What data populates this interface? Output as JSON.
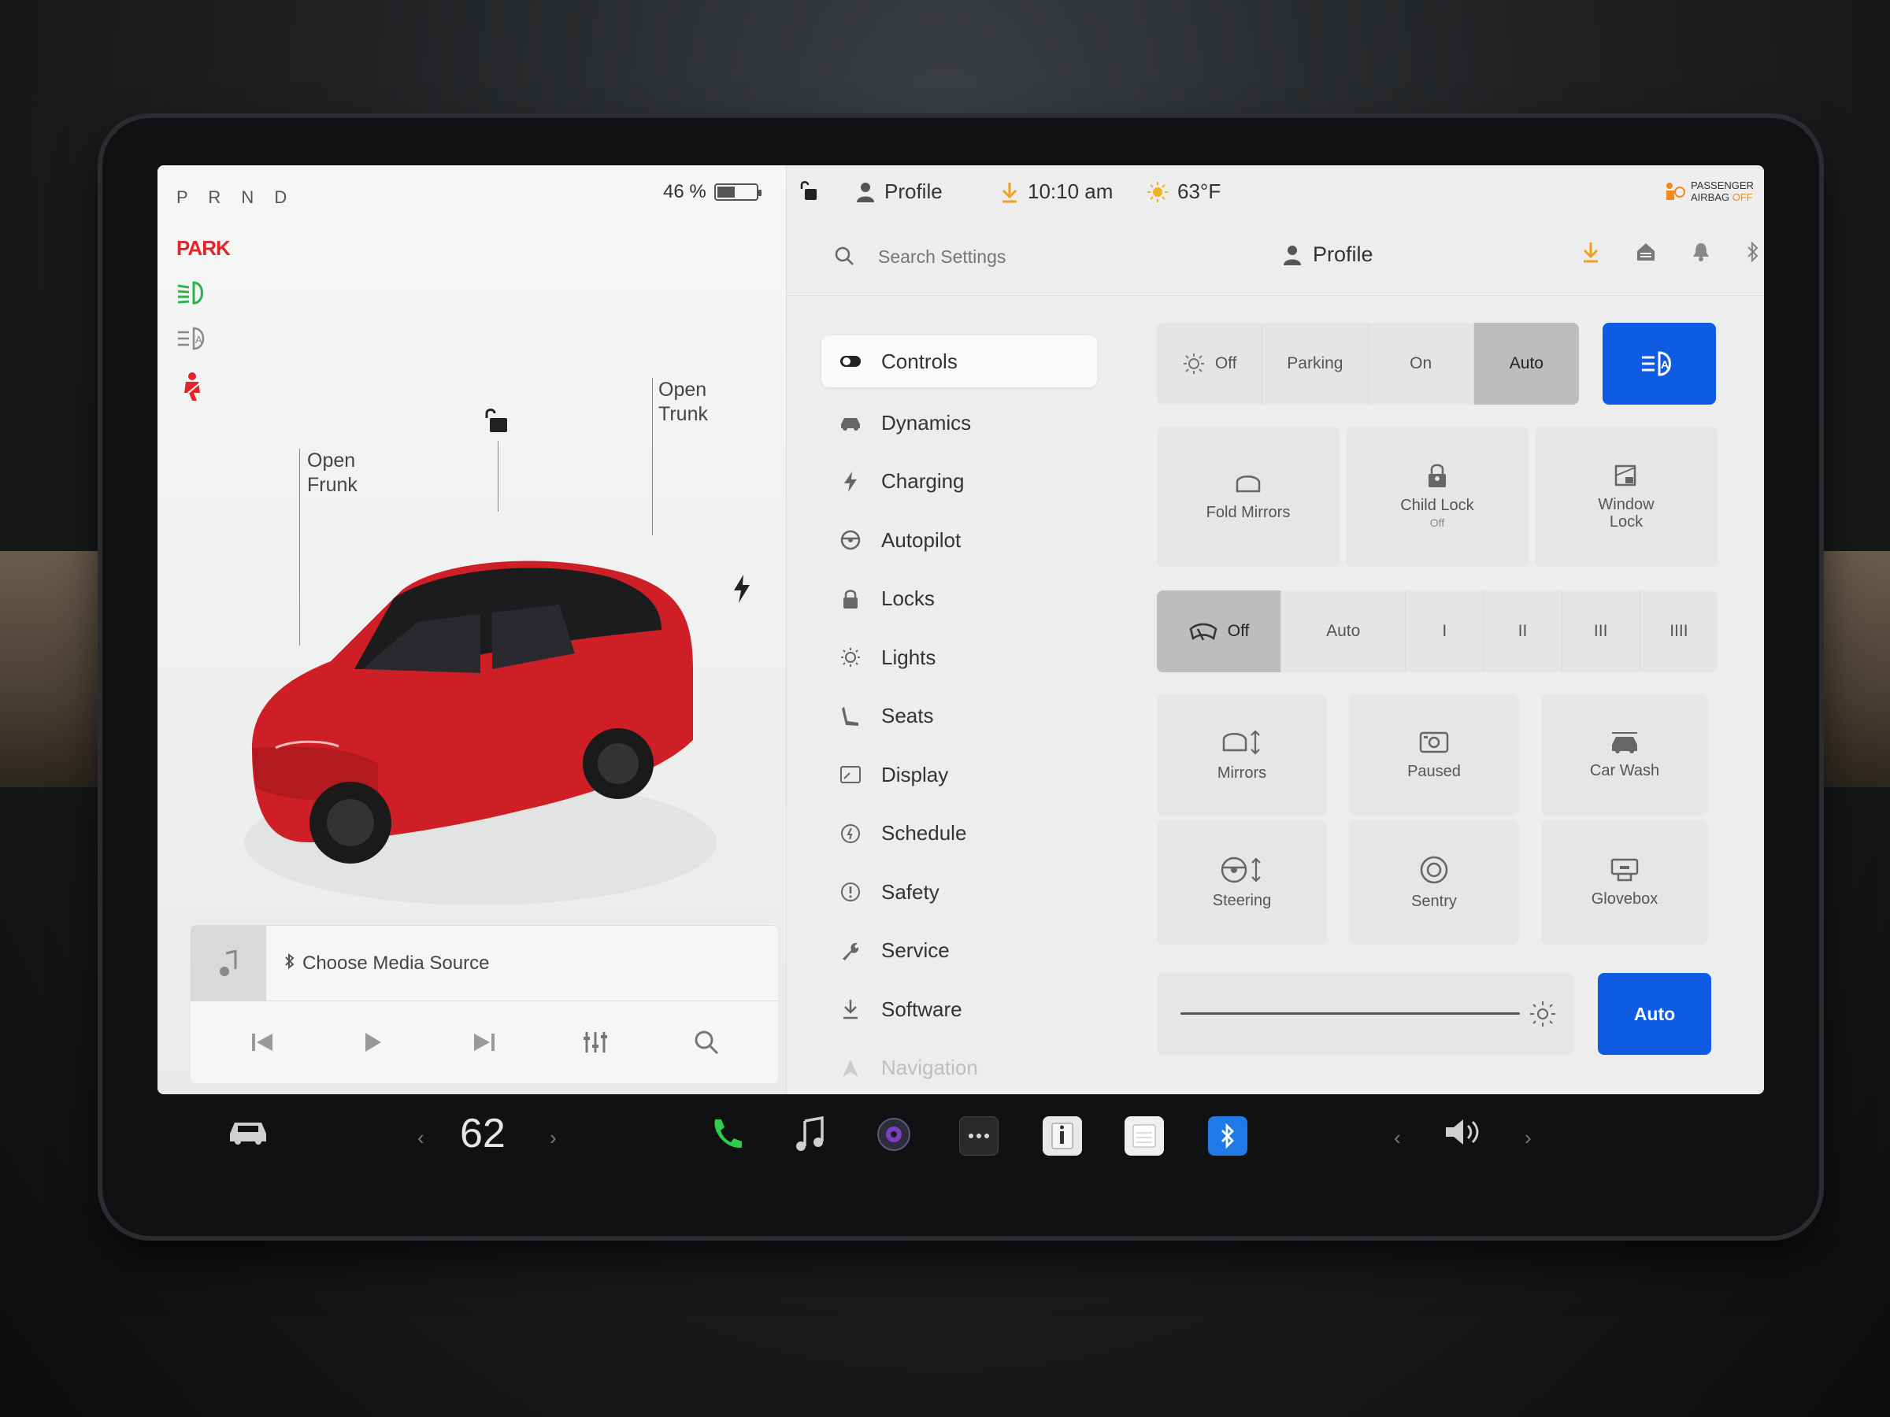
{
  "status": {
    "gear": "P R N D",
    "park_label": "PARK",
    "battery_pct_text": "46 %",
    "battery_level": 0.46
  },
  "car": {
    "frunk_label_1": "Open",
    "frunk_label_2": "Frunk",
    "trunk_label_1": "Open",
    "trunk_label_2": "Trunk"
  },
  "topbar": {
    "profile": "Profile",
    "time": "10:10 am",
    "temp": "63°F",
    "airbag_line1": "PASSENGER",
    "airbag_line2": "AIRBAG",
    "airbag_off": "OFF"
  },
  "search": {
    "placeholder": "Search Settings",
    "profile": "Profile"
  },
  "menu": [
    {
      "label": "Controls"
    },
    {
      "label": "Dynamics"
    },
    {
      "label": "Charging"
    },
    {
      "label": "Autopilot"
    },
    {
      "label": "Locks"
    },
    {
      "label": "Lights"
    },
    {
      "label": "Seats"
    },
    {
      "label": "Display"
    },
    {
      "label": "Schedule"
    },
    {
      "label": "Safety"
    },
    {
      "label": "Service"
    },
    {
      "label": "Software"
    },
    {
      "label": "Navigation"
    }
  ],
  "lights": {
    "off": "Off",
    "parking": "Parking",
    "on": "On",
    "auto": "Auto"
  },
  "tiles1": {
    "fold_mirrors": "Fold Mirrors",
    "child_lock": "Child Lock",
    "child_lock_state": "Off",
    "window_lock_1": "Window",
    "window_lock_2": "Lock"
  },
  "wipers": {
    "off": "Off",
    "auto": "Auto",
    "s1": "I",
    "s2": "II",
    "s3": "III",
    "s4": "IIII"
  },
  "tiles2": {
    "mirrors": "Mirrors",
    "paused": "Paused",
    "car_wash": "Car Wash",
    "steering": "Steering",
    "sentry": "Sentry",
    "glovebox": "Glovebox"
  },
  "brightness": {
    "auto": "Auto",
    "level": 0.98
  },
  "media": {
    "source": "Choose Media Source"
  },
  "dock": {
    "cabin_temp": "62"
  }
}
